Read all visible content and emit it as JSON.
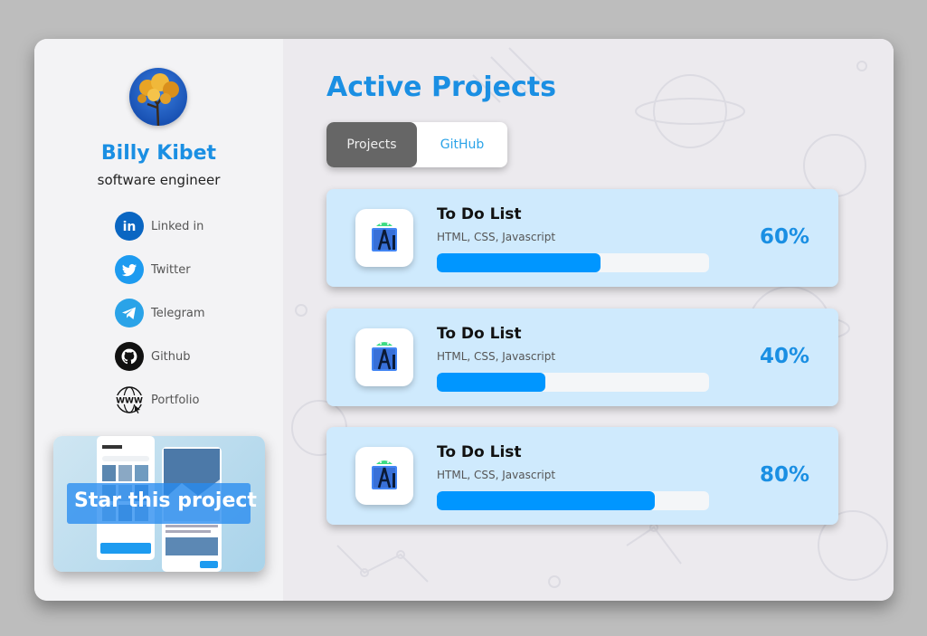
{
  "profile": {
    "name": "Billy Kibet",
    "role": "software engineer"
  },
  "socials": [
    {
      "label": "Linked in",
      "icon": "linkedin-icon",
      "color": "#0a66c2"
    },
    {
      "label": "Twitter",
      "icon": "twitter-icon",
      "color": "#1d9bf0"
    },
    {
      "label": "Telegram",
      "icon": "telegram-icon",
      "color": "#2aa3e8"
    },
    {
      "label": "Github",
      "icon": "github-icon",
      "color": "#111111"
    },
    {
      "label": "Portfolio",
      "icon": "www-globe-icon",
      "color": "#111111"
    }
  ],
  "star_card": {
    "label": "Star this project"
  },
  "main": {
    "title": "Active Projects",
    "tabs": [
      {
        "label": "Projects",
        "active": true
      },
      {
        "label": "GitHub",
        "active": false
      }
    ]
  },
  "projects": [
    {
      "title": "To Do List",
      "tech": "HTML, CSS, Javascript",
      "percent_label": "60%",
      "progress": 0.6
    },
    {
      "title": "To Do List",
      "tech": "HTML, CSS, Javascript",
      "percent_label": "40%",
      "progress": 0.4
    },
    {
      "title": "To Do List",
      "tech": "HTML, CSS, Javascript",
      "percent_label": "80%",
      "progress": 0.8
    }
  ],
  "colors": {
    "accent": "#1a8fe3",
    "progress_fill": "#0096ff",
    "card_bg": "#cfeafd"
  }
}
